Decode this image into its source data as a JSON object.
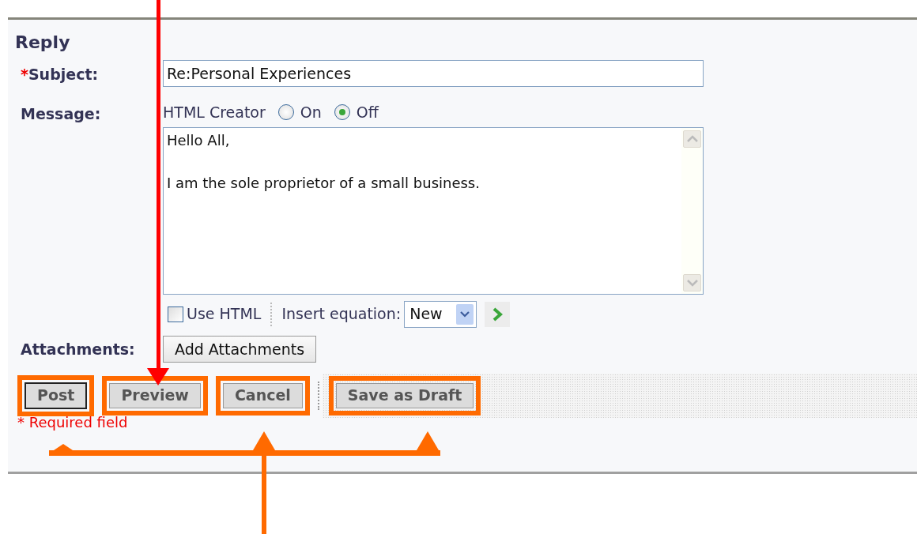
{
  "heading": "Reply",
  "subject": {
    "required_mark": "*",
    "label": "Subject:",
    "value": "Re:Personal Experiences"
  },
  "message": {
    "label": "Message:",
    "html_creator": {
      "label": "HTML Creator",
      "options": [
        {
          "label": "On",
          "selected": false
        },
        {
          "label": "Off",
          "selected": true
        }
      ]
    },
    "body": "Hello All,\n\nI am the sole proprietor of a small business.",
    "use_html": {
      "label": "Use HTML",
      "checked": false
    },
    "insert_equation": {
      "label": "Insert equation:",
      "value": "New"
    }
  },
  "attachments": {
    "label": "Attachments:",
    "button": "Add Attachments"
  },
  "actions": [
    {
      "label": "Post",
      "default": true,
      "highlighted": true
    },
    {
      "label": "Preview",
      "default": false,
      "highlighted": true
    },
    {
      "label": "Cancel",
      "default": false,
      "highlighted": true
    },
    {
      "label": "Save as Draft",
      "default": false,
      "highlighted": true
    }
  ],
  "required_note": "* Required field"
}
